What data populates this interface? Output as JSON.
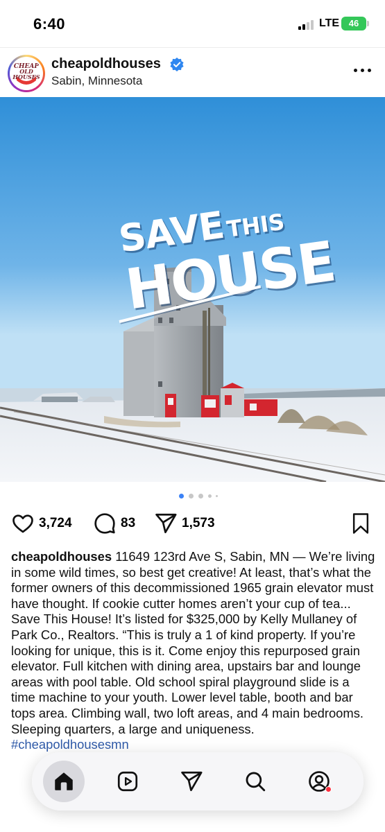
{
  "status_bar": {
    "time": "6:40",
    "network": "LTE",
    "battery": "46"
  },
  "post": {
    "username": "cheapoldhouses",
    "verified_icon": "verified-badge-icon",
    "location": "Sabin, Minnesota",
    "avatar_logo_text": "CHEAP OLD HOUSES"
  },
  "image": {
    "headline_line1": "SAVE",
    "headline_this": "THIS",
    "headline_line2": "HOUSE"
  },
  "carousel": {
    "count": 5,
    "active_index": 0
  },
  "actions": {
    "likes": "3,724",
    "comments": "83",
    "shares": "1,573"
  },
  "caption": {
    "username": "cheapoldhouses",
    "text": " 11649 123rd Ave S, Sabin, MN — We’re living in some wild times, so best get creative! At least, that’s what the former owners of this decommissioned 1965 grain elevator must have thought. If cookie cutter homes aren’t your cup of tea... Save This House! It’s listed for $325,000 by Kelly Mullaney of Park Co., Realtors. “This is truly a 1 of kind property. If you’re looking for unique, this is it. Come enjoy this repurposed grain elevator. Full kitchen with dining area, upstairs bar and lounge areas with pool table. Old school spiral playground slide is a time machine to your youth. Lower level table, booth and bar tops area. Climbing wall, two loft are",
    "hidden_text": "as, and 4 main bedrooms. Sleeping quarters, a large and uniqueness. ",
    "hashtag": "#cheapoldhousesmn"
  },
  "tabbar": {
    "items": [
      {
        "name": "home",
        "icon": "home-icon",
        "active": true
      },
      {
        "name": "reels",
        "icon": "reels-icon",
        "active": false
      },
      {
        "name": "messages",
        "icon": "send-icon",
        "active": false
      },
      {
        "name": "search",
        "icon": "search-icon",
        "active": false
      },
      {
        "name": "profile",
        "icon": "profile-icon",
        "active": false,
        "badge": true
      }
    ]
  },
  "colors": {
    "sky_top": "#2f8fd8",
    "sky_bottom": "#bfe0f5",
    "snow": "#eef1f5",
    "elevator": "#9ea3a8",
    "door_red": "#d3262f",
    "accent_blue": "#3b82f6",
    "verified_blue": "#2f87f0",
    "notification_red": "#ff3040"
  }
}
